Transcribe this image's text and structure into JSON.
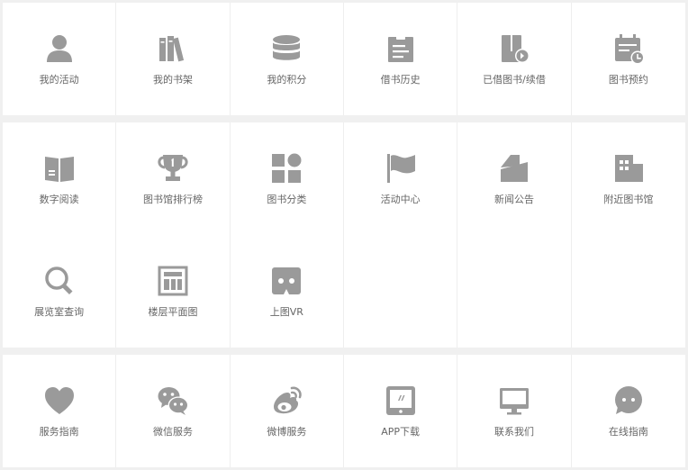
{
  "colors": {
    "icon": "#9a9a9a",
    "label": "#666666",
    "panel": "#ffffff",
    "background": "#f0f0f0"
  },
  "sections": [
    {
      "items": [
        {
          "label": "我的活动",
          "icon": "person-icon"
        },
        {
          "label": "我的书架",
          "icon": "bookshelf-icon"
        },
        {
          "label": "我的积分",
          "icon": "coin-stack-icon"
        },
        {
          "label": "借书历史",
          "icon": "clipboard-icon"
        },
        {
          "label": "已借图书/续借",
          "icon": "book-renew-icon"
        },
        {
          "label": "图书预约",
          "icon": "calendar-clock-icon"
        }
      ]
    },
    {
      "items": [
        {
          "label": "数字阅读",
          "icon": "open-book-icon"
        },
        {
          "label": "图书馆排行榜",
          "icon": "trophy-icon"
        },
        {
          "label": "图书分类",
          "icon": "category-grid-icon"
        },
        {
          "label": "活动中心",
          "icon": "flag-icon"
        },
        {
          "label": "新闻公告",
          "icon": "newspaper-icon"
        },
        {
          "label": "附近图书馆",
          "icon": "building-icon"
        },
        {
          "label": "展览室查询",
          "icon": "search-icon"
        },
        {
          "label": "楼层平面图",
          "icon": "floor-plan-icon"
        },
        {
          "label": "上图VR",
          "icon": "vr-glasses-icon"
        }
      ]
    },
    {
      "items": [
        {
          "label": "服务指南",
          "icon": "heart-icon"
        },
        {
          "label": "微信服务",
          "icon": "wechat-icon"
        },
        {
          "label": "微博服务",
          "icon": "weibo-icon"
        },
        {
          "label": "APP下载",
          "icon": "tablet-icon"
        },
        {
          "label": "联系我们",
          "icon": "monitor-icon"
        },
        {
          "label": "在线指南",
          "icon": "chat-bubble-icon"
        }
      ]
    }
  ]
}
